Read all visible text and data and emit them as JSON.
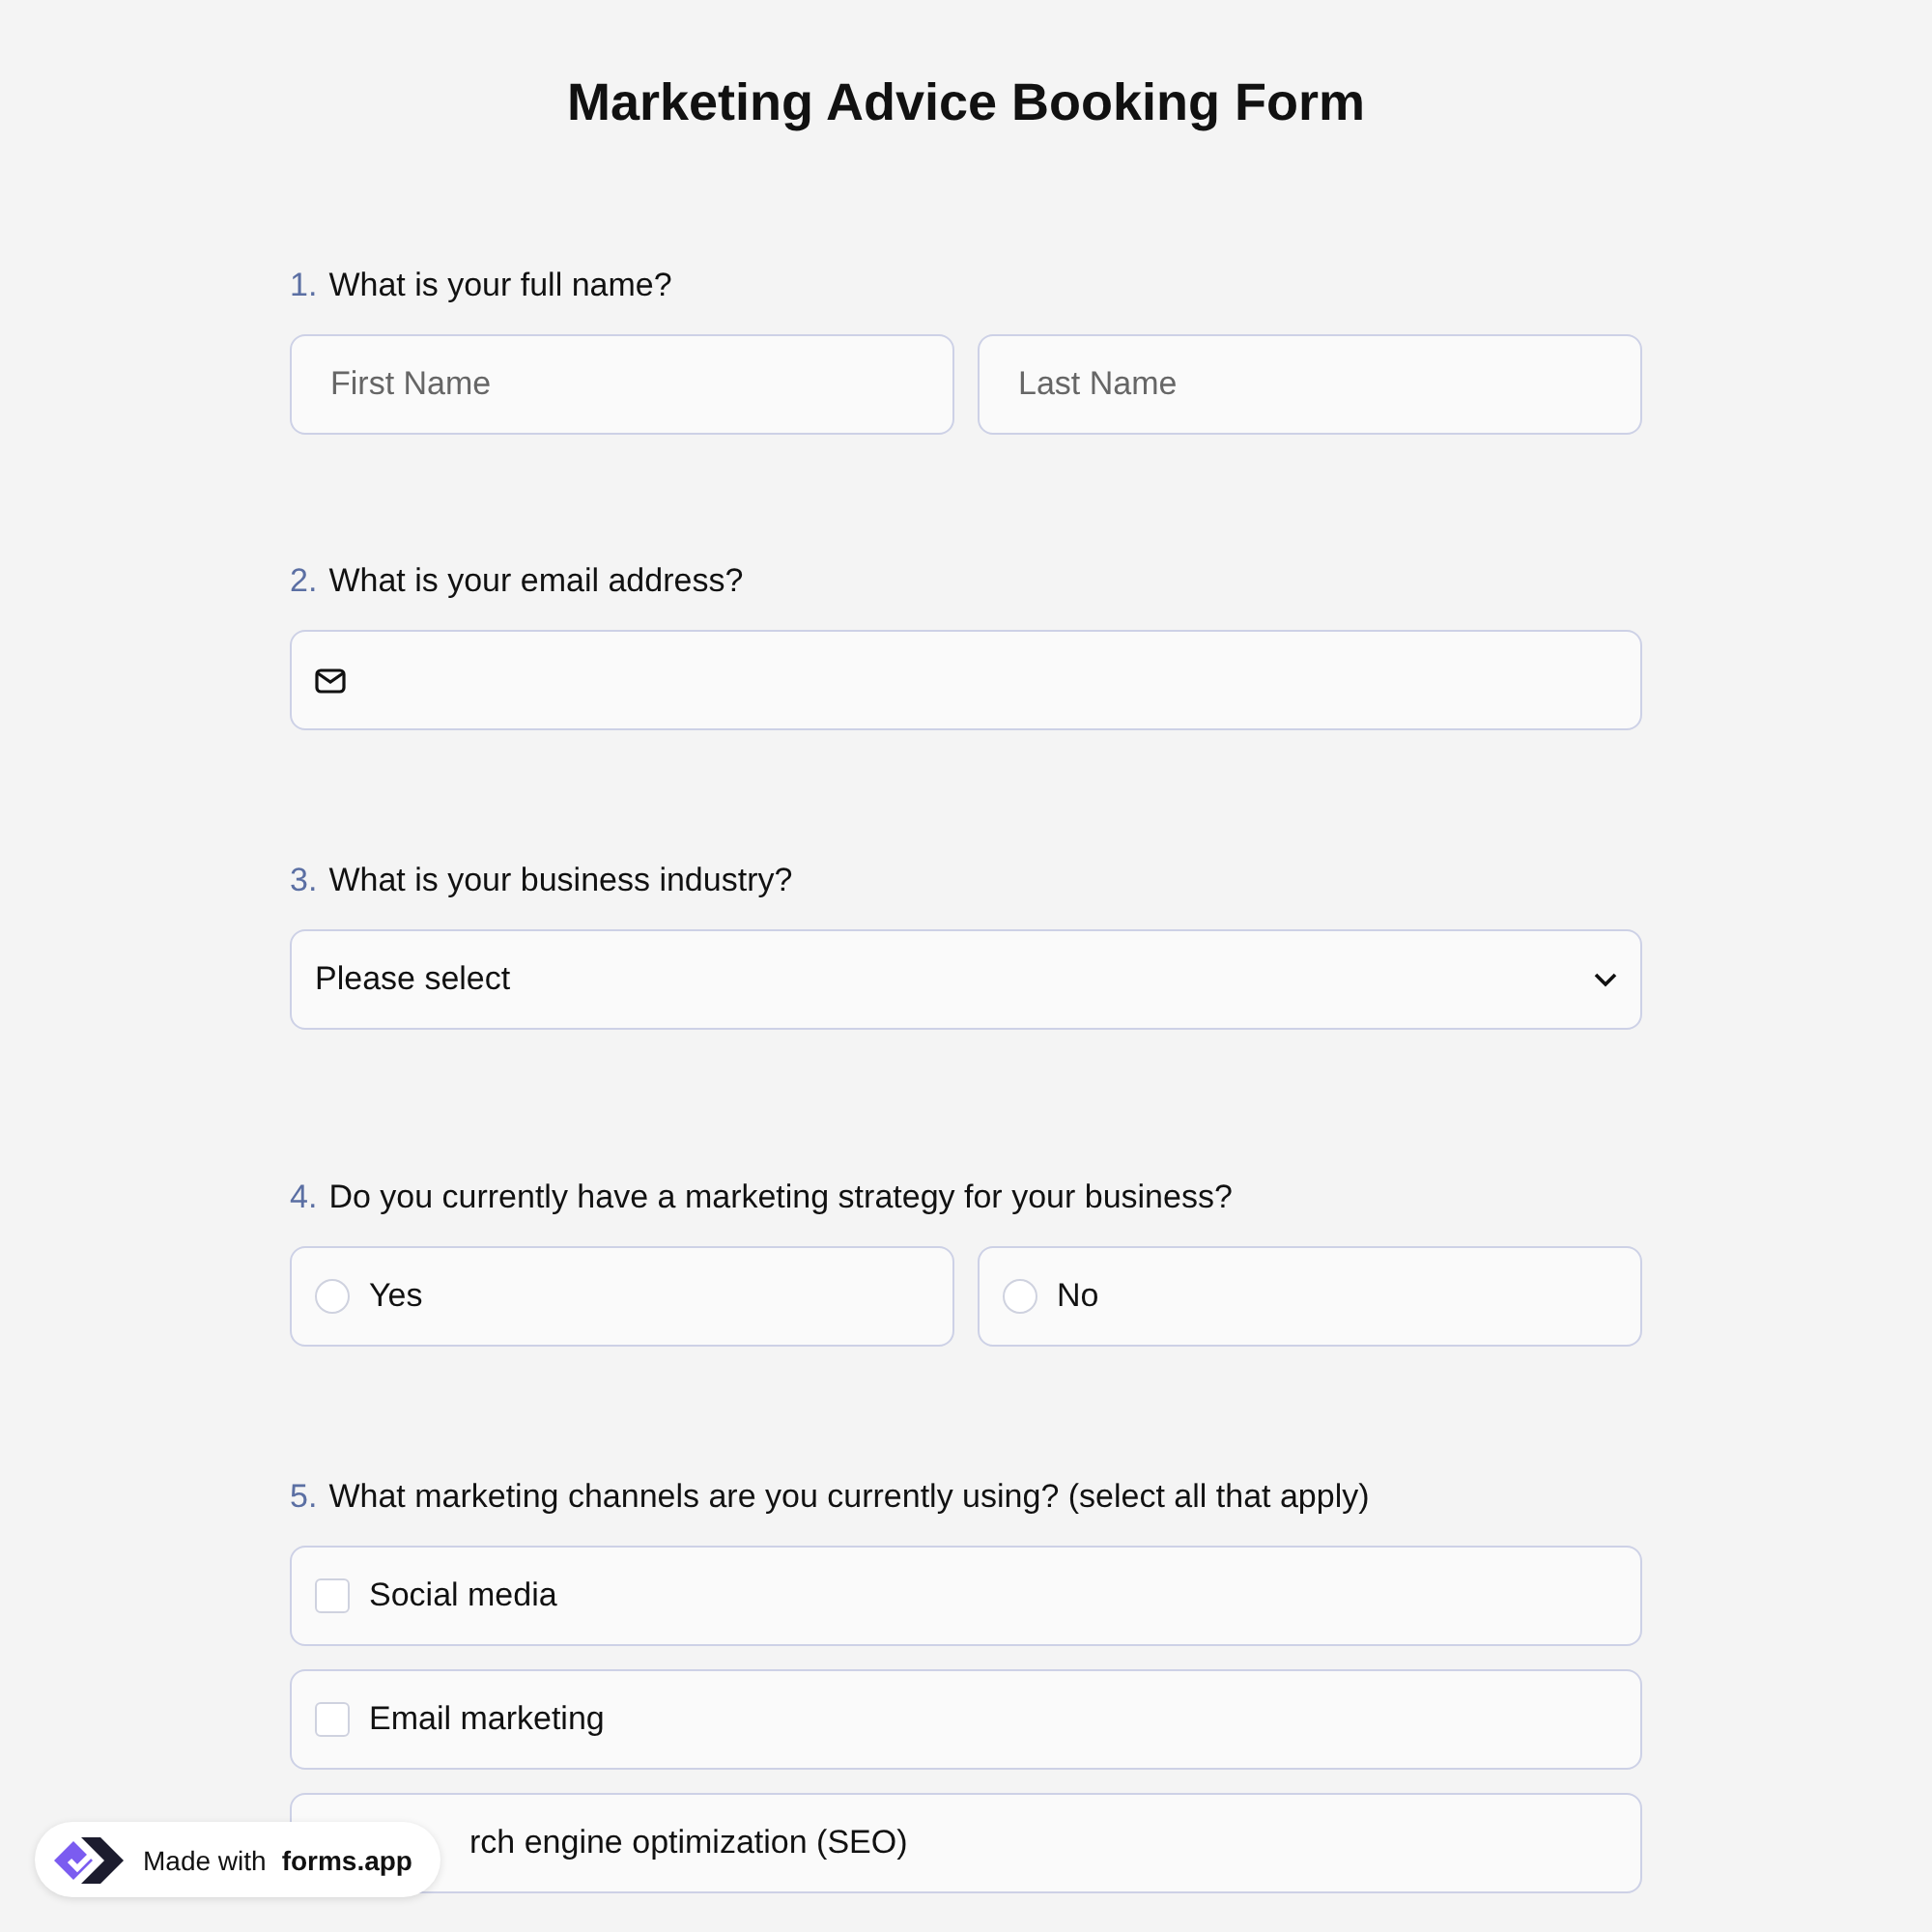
{
  "title": "Marketing Advice Booking Form",
  "questions": [
    {
      "number": "1.",
      "label": "What is your full name?",
      "kind": "name",
      "fields": [
        {
          "placeholder": "First Name"
        },
        {
          "placeholder": "Last Name"
        }
      ]
    },
    {
      "number": "2.",
      "label": "What is your email address?",
      "kind": "email"
    },
    {
      "number": "3.",
      "label": "What is your business industry?",
      "kind": "select",
      "value": "Please select"
    },
    {
      "number": "4.",
      "label": "Do you currently have a marketing strategy for your business?",
      "kind": "radio",
      "options": [
        {
          "label": "Yes",
          "selected": false
        },
        {
          "label": "No",
          "selected": false
        }
      ]
    },
    {
      "number": "5.",
      "label": "What marketing channels are you currently using? (select all that apply)",
      "kind": "checkbox",
      "options": [
        {
          "label": "Social media",
          "checked": false
        },
        {
          "label": "Email marketing",
          "checked": false
        },
        {
          "label": "rch engine optimization (SEO)",
          "covered": true
        }
      ]
    }
  ],
  "badge": {
    "prefix": "Made with",
    "brand": "forms.app"
  }
}
